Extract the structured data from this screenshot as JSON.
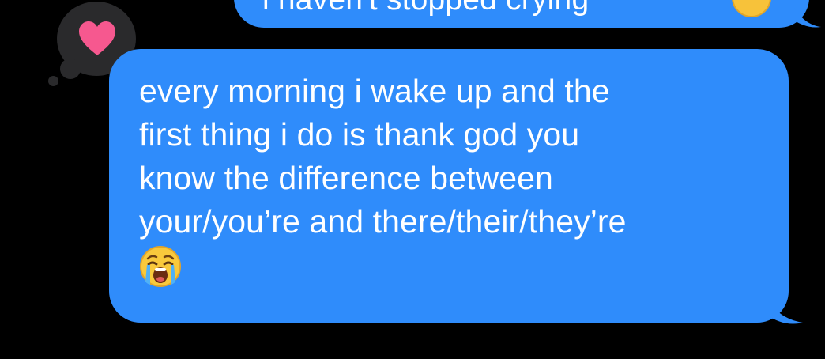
{
  "conversation": {
    "previous_message": {
      "visible_text": "i haven't stopped crying",
      "trailing_emoji": "grinning-sweat-emoji"
    },
    "tapback": {
      "icon": "heart-icon",
      "color": "#f6588f"
    },
    "current_message": {
      "lines": [
        "every morning i wake up and the",
        "first thing i do is thank god you",
        "know the difference between",
        "your/you’re and there/their/they’re"
      ],
      "emoji": "loudly-crying-face-emoji",
      "bubble_color": "#2f8cfb"
    }
  }
}
